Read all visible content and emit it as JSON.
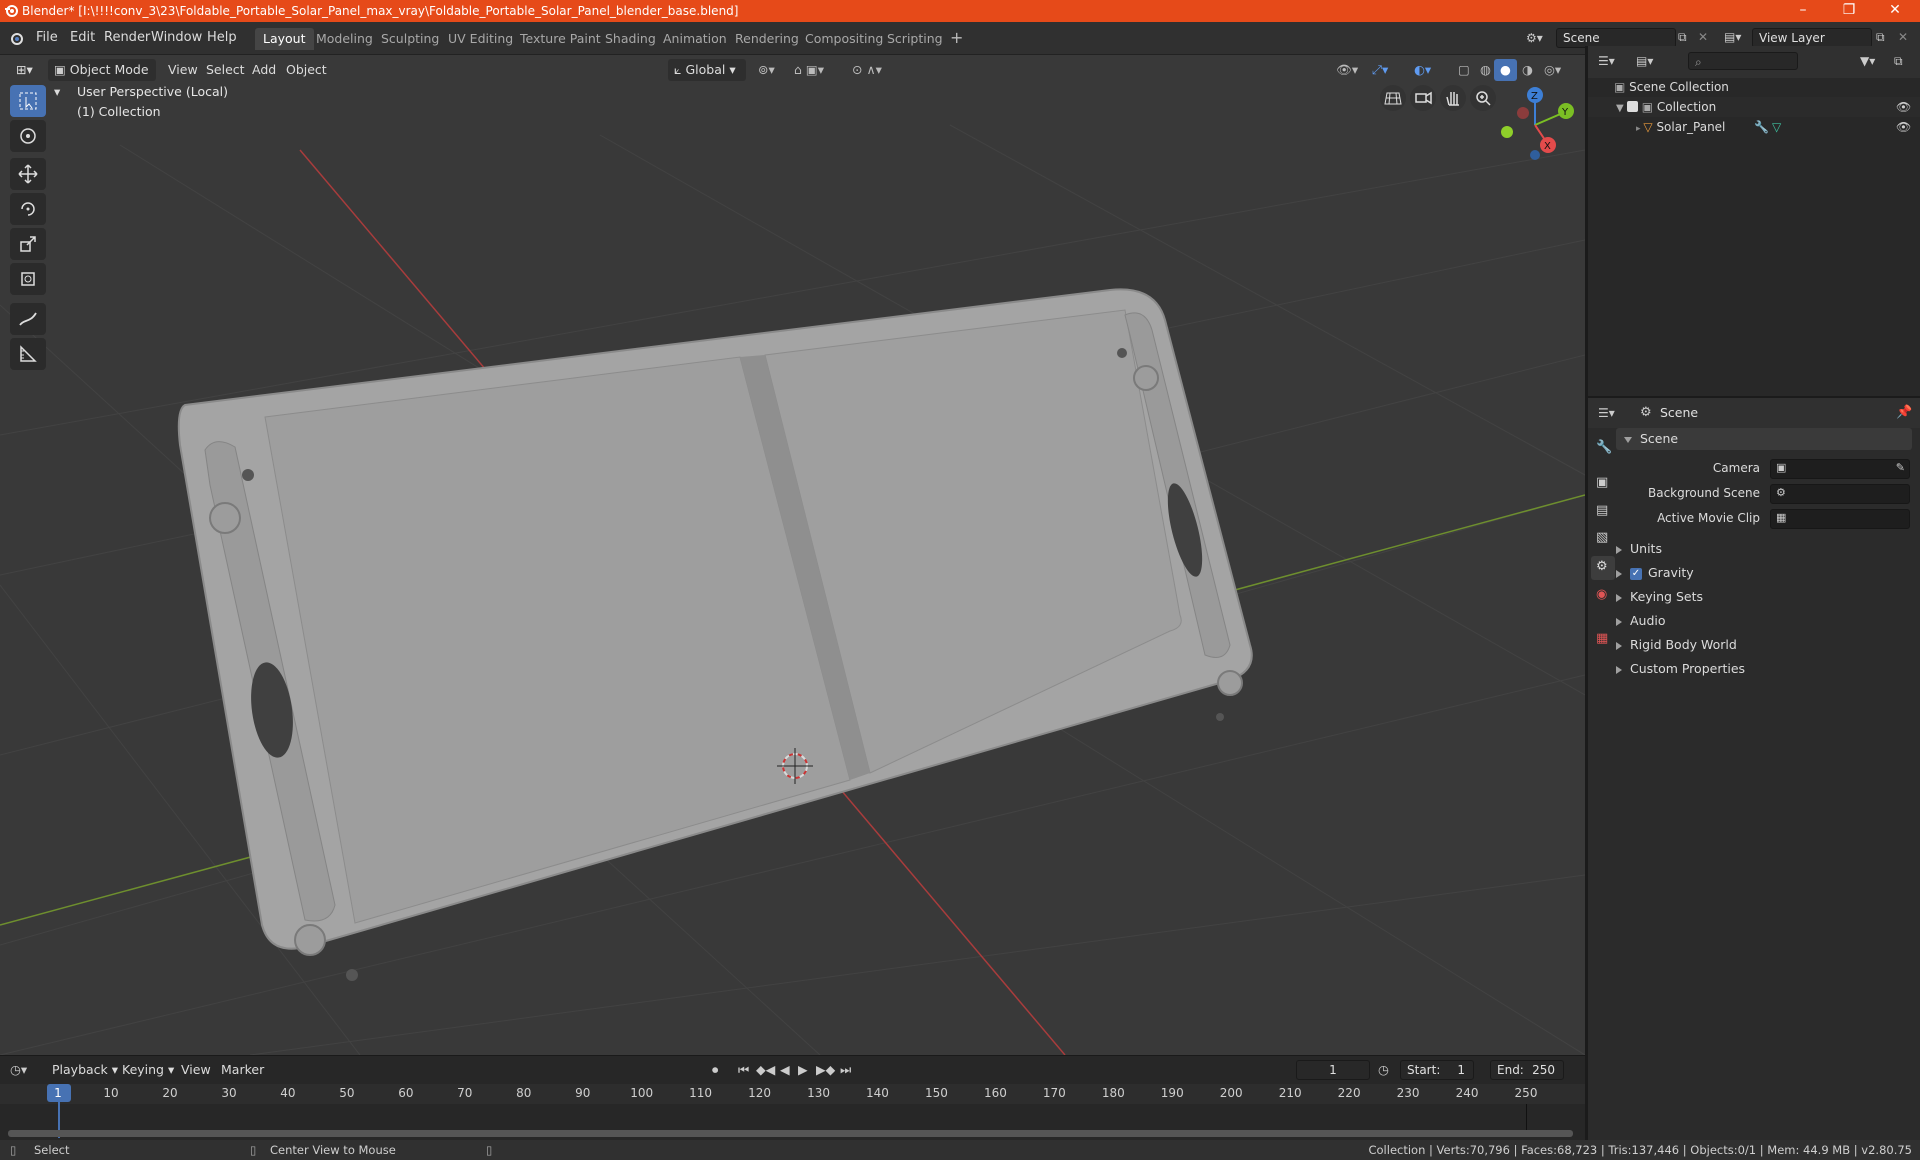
{
  "titlebar": {
    "title": "Blender* [I:\\!!!!conv_3\\23\\Foldable_Portable_Solar_Panel_max_vray\\Foldable_Portable_Solar_Panel_blender_base.blend]",
    "bg_color": "#e64a19"
  },
  "menubar": {
    "menus": [
      "File",
      "Edit",
      "Render",
      "Window",
      "Help"
    ],
    "workspaces": [
      "Layout",
      "Modeling",
      "Sculpting",
      "UV Editing",
      "Texture Paint",
      "Shading",
      "Animation",
      "Rendering",
      "Compositing",
      "Scripting"
    ],
    "active_workspace": "Layout",
    "scene_value": "Scene",
    "view_layer_value": "View Layer"
  },
  "viewport_header": {
    "mode": "Object Mode",
    "menus": [
      "View",
      "Select",
      "Add",
      "Object"
    ],
    "orientation": "Global"
  },
  "viewport": {
    "perspective_label": "User Perspective (Local)",
    "collection_label": "(1) Collection",
    "gizmo_axes": [
      "Z",
      "Y",
      "X"
    ],
    "bg_color": "#393939"
  },
  "outliner": {
    "root": "Scene Collection",
    "collection": "Collection",
    "object": "Solar_Panel"
  },
  "properties": {
    "context": "Scene",
    "panel_title": "Scene",
    "fields": [
      {
        "label": "Camera"
      },
      {
        "label": "Background Scene"
      },
      {
        "label": "Active Movie Clip"
      }
    ],
    "subpanels": [
      "Units",
      "Gravity",
      "Keying Sets",
      "Audio",
      "Rigid Body World",
      "Custom Properties"
    ],
    "gravity_checked": true
  },
  "timeline": {
    "menus": [
      "Playback",
      "Keying",
      "View",
      "Marker"
    ],
    "current_frame": "1",
    "start_label": "Start:",
    "start_value": "1",
    "end_label": "End:",
    "end_value": "250",
    "ticks": [
      "1",
      "10",
      "20",
      "30",
      "40",
      "50",
      "60",
      "70",
      "80",
      "90",
      "100",
      "110",
      "120",
      "130",
      "140",
      "150",
      "160",
      "170",
      "180",
      "190",
      "200",
      "210",
      "220",
      "230",
      "240",
      "250"
    ]
  },
  "statusbar": {
    "select": "Select",
    "center_view": "Center View to Mouse",
    "stats": "Collection | Verts:70,796 | Faces:68,723 | Tris:137,446 | Objects:0/1 | Mem: 44.9 MB | v2.80.75"
  }
}
